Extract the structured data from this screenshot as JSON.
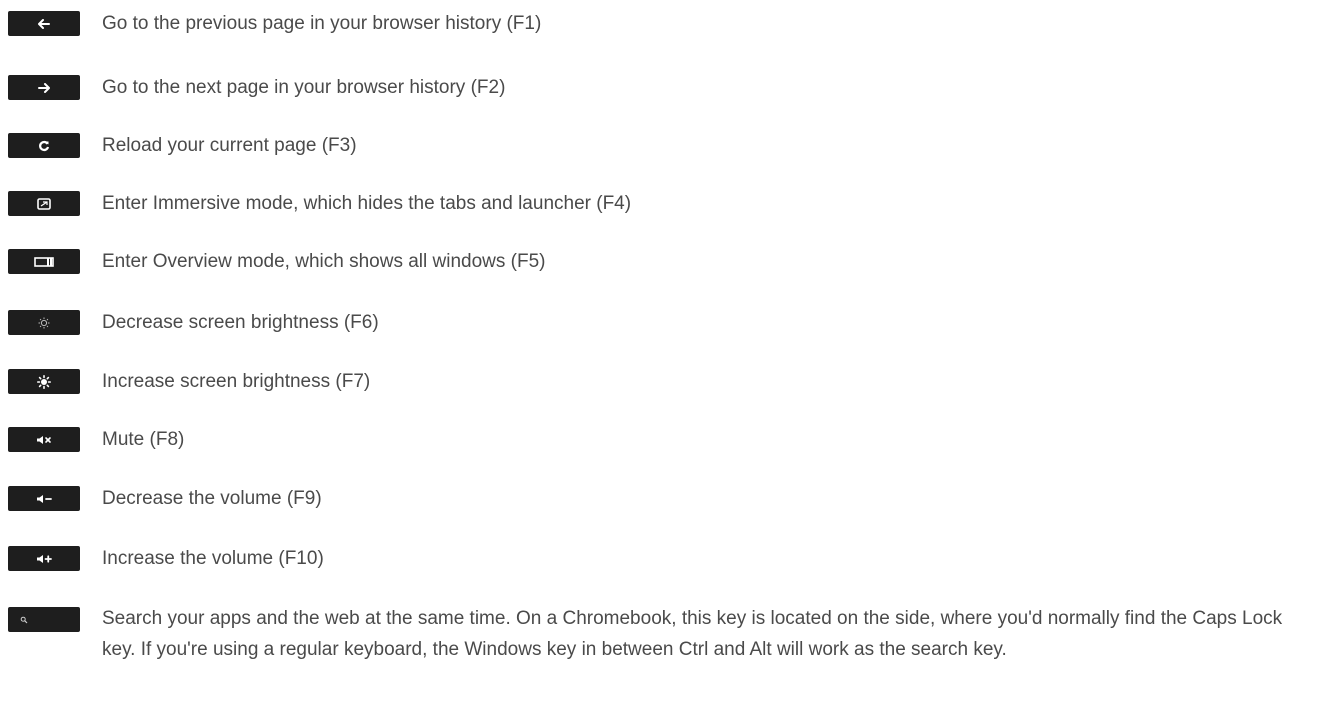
{
  "shortcuts": [
    {
      "icon": "back-arrow-icon",
      "description": "Go to the previous page in your browser history (F1)"
    },
    {
      "icon": "forward-arrow-icon",
      "description": "Go to the next page in your browser history (F2)"
    },
    {
      "icon": "reload-icon",
      "description": "Reload your current page (F3)"
    },
    {
      "icon": "fullscreen-icon",
      "description": "Enter Immersive mode, which hides the tabs and launcher (F4)"
    },
    {
      "icon": "overview-icon",
      "description": "Enter Overview mode, which shows all windows (F5)"
    },
    {
      "icon": "brightness-down-icon",
      "description": "Decrease screen brightness (F6)"
    },
    {
      "icon": "brightness-up-icon",
      "description": "Increase screen brightness (F7)"
    },
    {
      "icon": "mute-icon",
      "description": "Mute (F8)"
    },
    {
      "icon": "volume-down-icon",
      "description": "Decrease the volume (F9)"
    },
    {
      "icon": "volume-up-icon",
      "description": "Increase the volume (F10)"
    },
    {
      "icon": "search-icon",
      "description": "Search your apps and the web at the same time. On a Chromebook, this key is located on the side, where you'd normally find the Caps Lock key. If you're using a regular keyboard, the Windows key in between Ctrl and Alt will work as the search key."
    }
  ],
  "colors": {
    "key_background": "#1e1e1e",
    "key_glyph": "#ffffff",
    "text": "#4a4a4a",
    "page_background": "#ffffff"
  }
}
